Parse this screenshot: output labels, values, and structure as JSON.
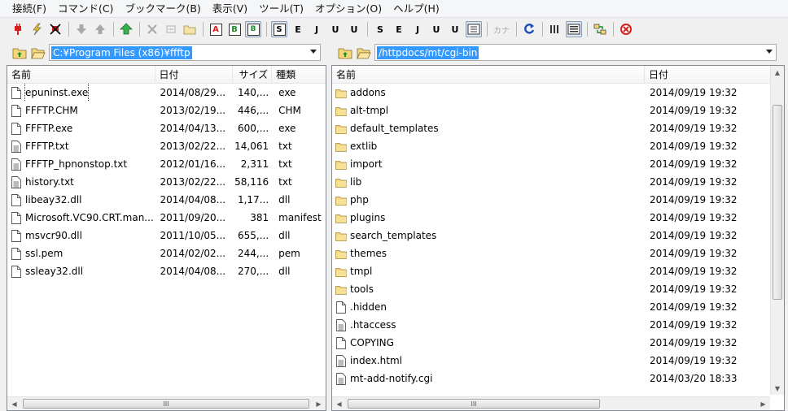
{
  "menu": [
    "接続(F)",
    "コマンド(C)",
    "ブックマーク(B)",
    "表示(V)",
    "ツール(T)",
    "オプション(O)",
    "ヘルプ(H)"
  ],
  "toolbar": {
    "letters": {
      "a": "A",
      "b": "B",
      "kana": "カナ",
      "j": "J",
      "e": "E",
      "s": "S",
      "u": "U"
    }
  },
  "local": {
    "path": "C:¥Program Files (x86)¥ffftp",
    "headers": {
      "name": "名前",
      "date": "日付",
      "size": "サイズ",
      "type": "種類"
    },
    "files": [
      {
        "name": "epuninst.exe",
        "date": "2014/08/29...",
        "size": "140,...",
        "type": "exe",
        "icon": "file-icon"
      },
      {
        "name": "FFFTP.CHM",
        "date": "2013/02/19...",
        "size": "446,...",
        "type": "CHM",
        "icon": "file-icon"
      },
      {
        "name": "FFFTP.exe",
        "date": "2014/04/13...",
        "size": "600,...",
        "type": "exe",
        "icon": "file-icon"
      },
      {
        "name": "FFFTP.txt",
        "date": "2013/02/22...",
        "size": "14,061",
        "type": "txt",
        "icon": "text-file-icon"
      },
      {
        "name": "FFFTP_hpnonstop.txt",
        "date": "2012/01/16...",
        "size": "2,311",
        "type": "txt",
        "icon": "text-file-icon"
      },
      {
        "name": "history.txt",
        "date": "2013/02/22...",
        "size": "58,116",
        "type": "txt",
        "icon": "text-file-icon"
      },
      {
        "name": "libeay32.dll",
        "date": "2014/04/08...",
        "size": "1,17...",
        "type": "dll",
        "icon": "file-icon"
      },
      {
        "name": "Microsoft.VC90.CRT.man...",
        "date": "2011/09/20...",
        "size": "381",
        "type": "manifest",
        "icon": "file-icon"
      },
      {
        "name": "msvcr90.dll",
        "date": "2011/10/05...",
        "size": "655,...",
        "type": "dll",
        "icon": "file-icon"
      },
      {
        "name": "ssl.pem",
        "date": "2014/02/02...",
        "size": "244,...",
        "type": "pem",
        "icon": "file-icon"
      },
      {
        "name": "ssleay32.dll",
        "date": "2014/04/08...",
        "size": "270,...",
        "type": "dll",
        "icon": "file-icon"
      }
    ],
    "scroll_grip": "III"
  },
  "remote": {
    "path": "/httpdocs/mt/cgi-bin",
    "headers": {
      "name": "名前",
      "date": "日付"
    },
    "files": [
      {
        "name": "addons",
        "date": "2014/09/19 19:32",
        "icon": "folder-icon"
      },
      {
        "name": "alt-tmpl",
        "date": "2014/09/19 19:32",
        "icon": "folder-icon"
      },
      {
        "name": "default_templates",
        "date": "2014/09/19 19:32",
        "icon": "folder-icon"
      },
      {
        "name": "extlib",
        "date": "2014/09/19 19:32",
        "icon": "folder-icon"
      },
      {
        "name": "import",
        "date": "2014/09/19 19:32",
        "icon": "folder-icon"
      },
      {
        "name": "lib",
        "date": "2014/09/19 19:32",
        "icon": "folder-icon"
      },
      {
        "name": "php",
        "date": "2014/09/19 19:32",
        "icon": "folder-icon"
      },
      {
        "name": "plugins",
        "date": "2014/09/19 19:32",
        "icon": "folder-icon"
      },
      {
        "name": "search_templates",
        "date": "2014/09/19 19:32",
        "icon": "folder-icon"
      },
      {
        "name": "themes",
        "date": "2014/09/19 19:32",
        "icon": "folder-icon"
      },
      {
        "name": "tmpl",
        "date": "2014/09/19 19:32",
        "icon": "folder-icon"
      },
      {
        "name": "tools",
        "date": "2014/09/19 19:32",
        "icon": "folder-icon"
      },
      {
        "name": ".hidden",
        "date": "2014/09/19 19:32",
        "icon": "file-icon"
      },
      {
        "name": ".htaccess",
        "date": "2014/09/19 19:32",
        "icon": "text-file-icon"
      },
      {
        "name": "COPYING",
        "date": "2014/09/19 19:32",
        "icon": "file-icon"
      },
      {
        "name": "index.html",
        "date": "2014/09/19 19:32",
        "icon": "text-file-icon"
      },
      {
        "name": "mt-add-notify.cgi",
        "date": "2014/03/20 18:33",
        "icon": "text-file-icon"
      }
    ],
    "scroll_grip": "III"
  },
  "colors": {
    "selection": "#3399ff",
    "folder": "#f3d57a",
    "connect": "#d62020",
    "refresh": "#1d4fb8"
  }
}
